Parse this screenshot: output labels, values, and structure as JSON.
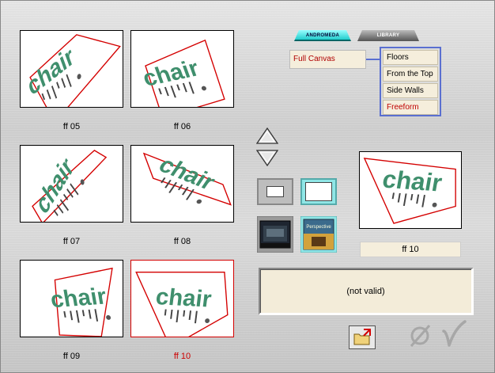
{
  "tabs": [
    {
      "label": "ANDROMEDA",
      "active": true
    },
    {
      "label": "LIBRARY",
      "active": false
    }
  ],
  "mode": {
    "current": "Full Canvas",
    "options": [
      {
        "label": "Floors",
        "highlight": false
      },
      {
        "label": "From the Top",
        "highlight": false
      },
      {
        "label": "Side Walls",
        "highlight": false
      },
      {
        "label": "Freeform",
        "highlight": true
      }
    ]
  },
  "thumbnails": [
    {
      "label": "ff 05",
      "selected": false
    },
    {
      "label": "ff 06",
      "selected": false
    },
    {
      "label": "ff 07",
      "selected": false
    },
    {
      "label": "ff 08",
      "selected": false
    },
    {
      "label": "ff 09",
      "selected": false
    },
    {
      "label": "ff 10",
      "selected": true
    }
  ],
  "thumbnail_word": "chair",
  "preview": {
    "label": "ff 10"
  },
  "status": {
    "text": "(not valid)"
  },
  "image_buttons": {
    "thumb2_text": "Perspective"
  },
  "icons": [
    "arrow-up-icon",
    "arrow-down-icon",
    "folder-export-icon",
    "cancel-icon",
    "checkmark-icon"
  ],
  "colors": {
    "accent_red": "#cc0000",
    "tab_active": "#33cccc",
    "list_border": "#5a6fd0",
    "field_bg": "#f5eedc"
  }
}
